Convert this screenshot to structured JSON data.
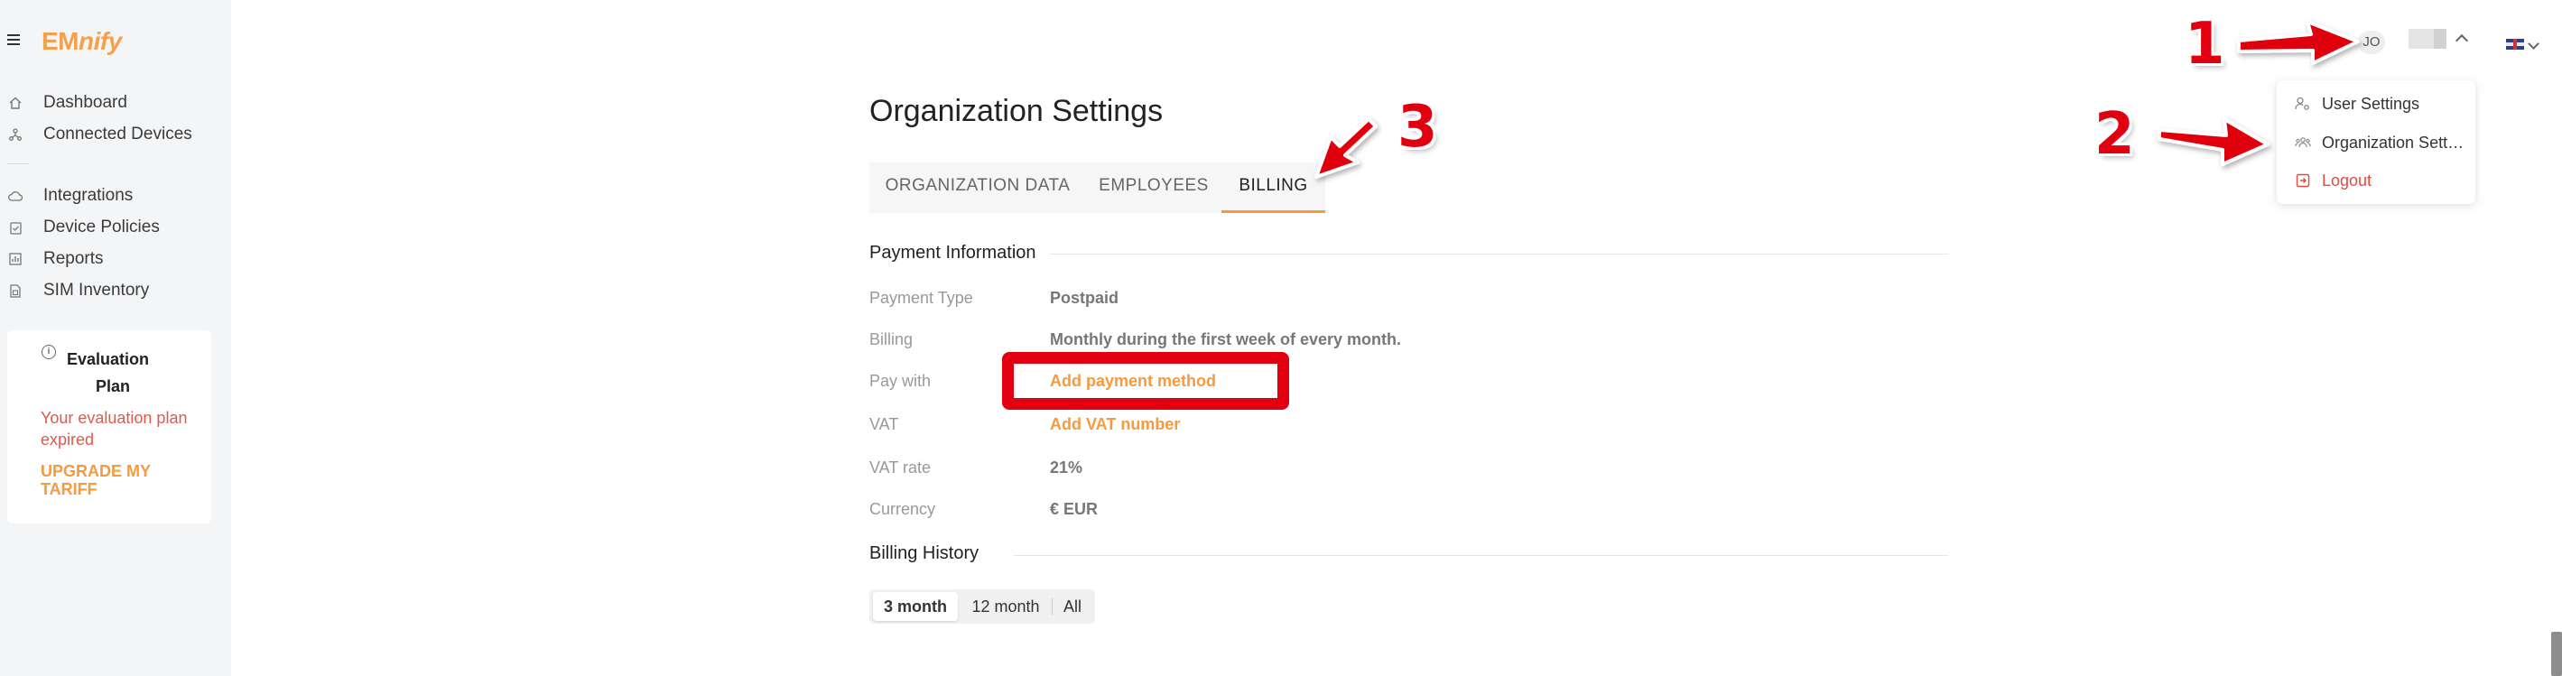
{
  "brand": {
    "logo_main": "EM",
    "logo_italic": "nify",
    "accent_color": "#f5a04a"
  },
  "sidebar": {
    "items": [
      {
        "label": "Dashboard",
        "icon": "home-icon"
      },
      {
        "label": "Connected Devices",
        "icon": "network-icon"
      },
      {
        "label": "Integrations",
        "icon": "cloud-icon"
      },
      {
        "label": "Device Policies",
        "icon": "clipboard-check-icon"
      },
      {
        "label": "Reports",
        "icon": "chart-icon"
      },
      {
        "label": "SIM Inventory",
        "icon": "sim-card-icon"
      }
    ],
    "evaluation": {
      "title_line1": "Evaluation",
      "title_line2": "Plan",
      "expired_text": "Your evaluation plan expired",
      "upgrade_label": "UPGRADE MY TARIFF"
    }
  },
  "header": {
    "avatar_initials": "JO"
  },
  "dropdown": {
    "items": [
      {
        "label": "User Settings",
        "icon": "user-gear-icon"
      },
      {
        "label": "Organization Settings",
        "icon": "users-icon"
      },
      {
        "label": "Logout",
        "icon": "logout-icon"
      }
    ]
  },
  "main": {
    "title": "Organization Settings",
    "tabs": [
      {
        "label": "ORGANIZATION DATA",
        "active": false
      },
      {
        "label": "EMPLOYEES",
        "active": false
      },
      {
        "label": "BILLING",
        "active": true
      }
    ],
    "payment": {
      "section_title": "Payment Information",
      "rows": [
        {
          "label": "Payment Type",
          "value": "Postpaid"
        },
        {
          "label": "Billing",
          "value": "Monthly during the first week of every month."
        },
        {
          "label": "Pay with",
          "value": "Add payment method"
        },
        {
          "label": "VAT",
          "value": "Add VAT number"
        },
        {
          "label": "VAT rate",
          "value": "21%"
        },
        {
          "label": "Currency",
          "value": "€ EUR"
        }
      ]
    },
    "history": {
      "section_title": "Billing History",
      "ranges": [
        {
          "label": "3 month",
          "active": true
        },
        {
          "label": "12 month",
          "active": false
        },
        {
          "label": "All",
          "active": false
        }
      ]
    }
  },
  "annotations": {
    "numbers": [
      "1",
      "2",
      "3"
    ],
    "color": "#e00010"
  }
}
